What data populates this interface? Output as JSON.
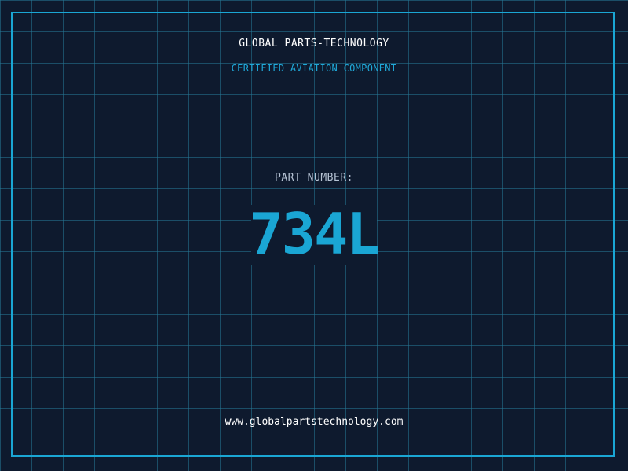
{
  "header": {
    "company": "GLOBAL PARTS-TECHNOLOGY",
    "subtitle": "CERTIFIED AVIATION COMPONENT"
  },
  "part": {
    "label": "PART NUMBER:",
    "number": "734L"
  },
  "footer": {
    "website": "www.globalpartstechnology.com"
  },
  "colors": {
    "background": "#0e1a2e",
    "accent": "#1aa6d4",
    "grid": "#267896"
  }
}
